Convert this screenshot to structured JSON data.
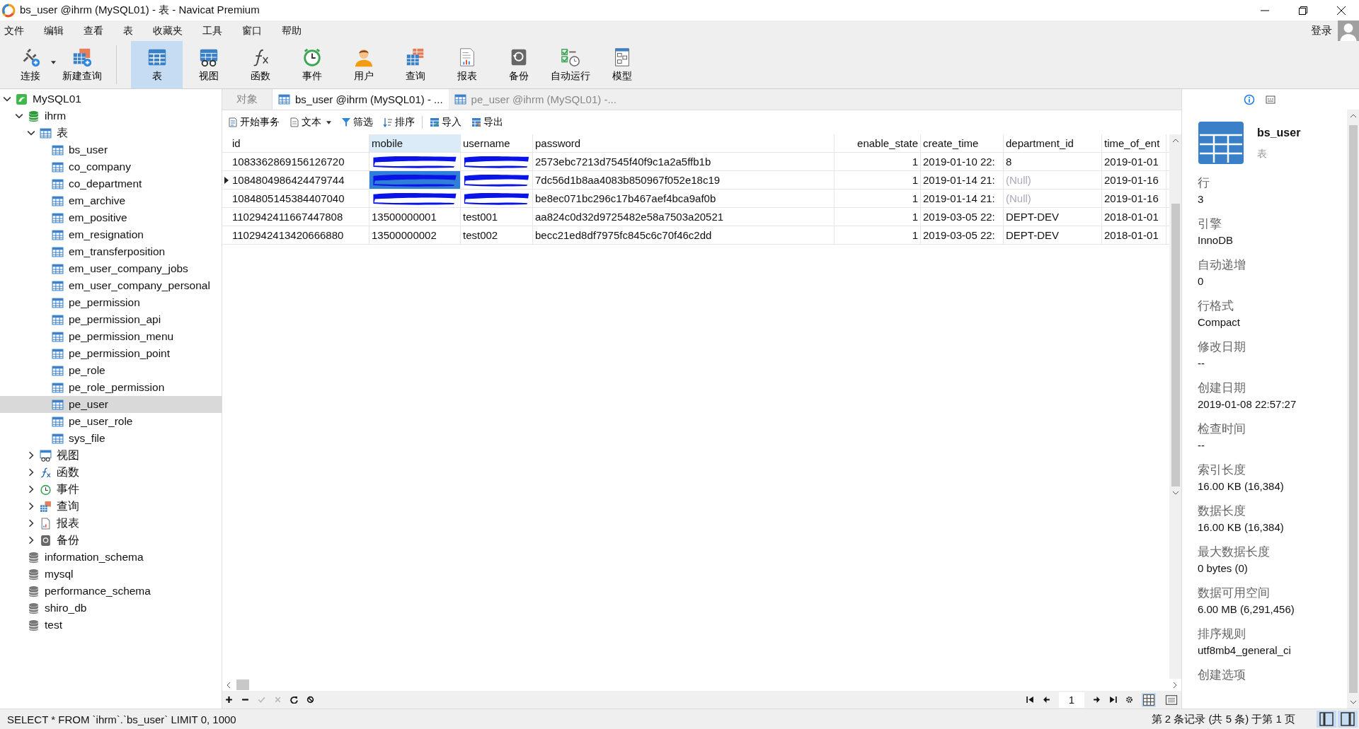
{
  "window": {
    "title": "bs_user @ihrm (MySQL01) - 表 - Navicat Premium"
  },
  "menu": [
    "文件",
    "编辑",
    "查看",
    "表",
    "收藏夹",
    "工具",
    "窗口",
    "帮助"
  ],
  "account": {
    "label": "登录"
  },
  "toolbar": [
    {
      "label": "连接",
      "kind": "connect",
      "selected": false,
      "dropdown": true
    },
    {
      "label": "新建查询",
      "kind": "new-query",
      "selected": false
    },
    {
      "label": "表",
      "kind": "table",
      "selected": true,
      "separator_before": true
    },
    {
      "label": "视图",
      "kind": "view",
      "selected": false
    },
    {
      "label": "函数",
      "kind": "function",
      "selected": false
    },
    {
      "label": "事件",
      "kind": "event",
      "selected": false
    },
    {
      "label": "用户",
      "kind": "user",
      "selected": false
    },
    {
      "label": "查询",
      "kind": "query",
      "selected": false
    },
    {
      "label": "报表",
      "kind": "report",
      "selected": false
    },
    {
      "label": "备份",
      "kind": "backup",
      "selected": false
    },
    {
      "label": "自动运行",
      "kind": "automation",
      "selected": false
    },
    {
      "label": "模型",
      "kind": "model",
      "selected": false
    }
  ],
  "tree": [
    {
      "label": "MySQL01",
      "kind": "server",
      "expanded": true,
      "selected": false,
      "children": [
        {
          "label": "ihrm",
          "kind": "database",
          "expanded": true,
          "selected": false,
          "children": [
            {
              "label": "表",
              "kind": "table",
              "expanded": true,
              "selected": false,
              "children": [
                {
                  "label": "bs_user",
                  "kind": "table",
                  "selected": false
                },
                {
                  "label": "co_company",
                  "kind": "table",
                  "selected": false
                },
                {
                  "label": "co_department",
                  "kind": "table",
                  "selected": false
                },
                {
                  "label": "em_archive",
                  "kind": "table",
                  "selected": false
                },
                {
                  "label": "em_positive",
                  "kind": "table",
                  "selected": false
                },
                {
                  "label": "em_resignation",
                  "kind": "table",
                  "selected": false
                },
                {
                  "label": "em_transferposition",
                  "kind": "table",
                  "selected": false
                },
                {
                  "label": "em_user_company_jobs",
                  "kind": "table",
                  "selected": false
                },
                {
                  "label": "em_user_company_personal",
                  "kind": "table",
                  "selected": false
                },
                {
                  "label": "pe_permission",
                  "kind": "table",
                  "selected": false
                },
                {
                  "label": "pe_permission_api",
                  "kind": "table",
                  "selected": false
                },
                {
                  "label": "pe_permission_menu",
                  "kind": "table",
                  "selected": false
                },
                {
                  "label": "pe_permission_point",
                  "kind": "table",
                  "selected": false
                },
                {
                  "label": "pe_role",
                  "kind": "table",
                  "selected": false
                },
                {
                  "label": "pe_role_permission",
                  "kind": "table",
                  "selected": false
                },
                {
                  "label": "pe_user",
                  "kind": "table",
                  "selected": true
                },
                {
                  "label": "pe_user_role",
                  "kind": "table",
                  "selected": false
                },
                {
                  "label": "sys_file",
                  "kind": "table",
                  "selected": false
                }
              ]
            },
            {
              "label": "视图",
              "kind": "view",
              "expanded": false,
              "selected": false
            },
            {
              "label": "函数",
              "kind": "function",
              "expanded": false,
              "selected": false
            },
            {
              "label": "事件",
              "kind": "event",
              "expanded": false,
              "selected": false
            },
            {
              "label": "查询",
              "kind": "query",
              "expanded": false,
              "selected": false
            },
            {
              "label": "报表",
              "kind": "report",
              "expanded": false,
              "selected": false
            },
            {
              "label": "备份",
              "kind": "backup",
              "expanded": false,
              "selected": false
            }
          ]
        },
        {
          "label": "information_schema",
          "kind": "database-closed",
          "selected": false
        },
        {
          "label": "mysql",
          "kind": "database-closed",
          "selected": false
        },
        {
          "label": "performance_schema",
          "kind": "database-closed",
          "selected": false
        },
        {
          "label": "shiro_db",
          "kind": "database-closed",
          "selected": false
        },
        {
          "label": "test",
          "kind": "database-closed",
          "selected": false
        }
      ]
    }
  ],
  "tabs": [
    {
      "label": "对象",
      "kind": "objects",
      "selected": false
    },
    {
      "label": "bs_user @ihrm (MySQL01) - ...",
      "kind": "table",
      "selected": true
    },
    {
      "label": "pe_user @ihrm (MySQL01) -...",
      "kind": "table",
      "selected": false
    }
  ],
  "grid_toolbar": [
    {
      "label": "开始事务",
      "kind": "transaction"
    },
    {
      "label": "文本",
      "kind": "text",
      "dropdown": true
    },
    {
      "label": "筛选",
      "kind": "filter"
    },
    {
      "label": "排序",
      "kind": "sort"
    },
    {
      "label": "导入",
      "kind": "import"
    },
    {
      "label": "导出",
      "kind": "export"
    }
  ],
  "grid": {
    "columns": [
      {
        "name": "id",
        "selected": false
      },
      {
        "name": "mobile",
        "selected": true
      },
      {
        "name": "username",
        "selected": false
      },
      {
        "name": "password",
        "selected": false
      },
      {
        "name": "enable_state",
        "selected": false
      },
      {
        "name": "create_time",
        "selected": false
      },
      {
        "name": "department_id",
        "selected": false
      },
      {
        "name": "time_of_ent",
        "selected": false
      }
    ],
    "rows": [
      {
        "selected": false,
        "cells": [
          "1083362869156126720",
          {
            "kind": "redacted"
          },
          {
            "kind": "redacted"
          },
          "2573ebc7213d7545f40f9c1a2a5ffb1b",
          "1",
          "2019-01-10 22:",
          "8",
          "2019-01-01"
        ]
      },
      {
        "selected": true,
        "cells": [
          "1084804986424479744",
          {
            "kind": "redacted"
          },
          {
            "kind": "redacted"
          },
          "7dc56d1b8aa4083b850967f052e18c19",
          "1",
          "2019-01-14 21:",
          {
            "kind": "null",
            "text": "(Null)"
          },
          "2019-01-16"
        ]
      },
      {
        "selected": false,
        "cells": [
          "1084805145384407040",
          {
            "kind": "redacted"
          },
          {
            "kind": "redacted"
          },
          "be8ec071bc296c17b467aef4bca9af0b",
          "1",
          "2019-01-14 21:",
          {
            "kind": "null",
            "text": "(Null)"
          },
          "2019-01-16"
        ]
      },
      {
        "selected": false,
        "cells": [
          "1102942411667447808",
          "13500000001",
          "test001",
          "aa824c0d32d9725482e58a7503a20521",
          "1",
          "2019-03-05 22:",
          "DEPT-DEV",
          "2018-01-01"
        ]
      },
      {
        "selected": false,
        "cells": [
          "1102942413420666880",
          "13500000002",
          "test002",
          "becc21ed8df7975fc845c6c70f46c2dd",
          "1",
          "2019-03-05 22:",
          "DEPT-DEV",
          "2018-01-01"
        ]
      }
    ]
  },
  "pager": {
    "page": "1"
  },
  "info_panel": {
    "name": "bs_user",
    "type": "表",
    "properties": [
      {
        "label": "行",
        "value": "3"
      },
      {
        "label": "引擎",
        "value": "InnoDB"
      },
      {
        "label": "自动递增",
        "value": "0"
      },
      {
        "label": "行格式",
        "value": "Compact"
      },
      {
        "label": "修改日期",
        "value": "--"
      },
      {
        "label": "创建日期",
        "value": "2019-01-08 22:57:27"
      },
      {
        "label": "检查时间",
        "value": "--"
      },
      {
        "label": "索引长度",
        "value": "16.00 KB (16,384)"
      },
      {
        "label": "数据长度",
        "value": "16.00 KB (16,384)"
      },
      {
        "label": "最大数据长度",
        "value": "0 bytes (0)"
      },
      {
        "label": "数据可用空间",
        "value": "6.00 MB (6,291,456)"
      },
      {
        "label": "排序规则",
        "value": "utf8mb4_general_ci"
      },
      {
        "label": "创建选项"
      }
    ]
  },
  "status_bar": {
    "query": "SELECT * FROM `ihrm`.`bs_user` LIMIT 0, 1000",
    "record": "第 2 条记录 (共 5 条) 于第 1 页"
  }
}
